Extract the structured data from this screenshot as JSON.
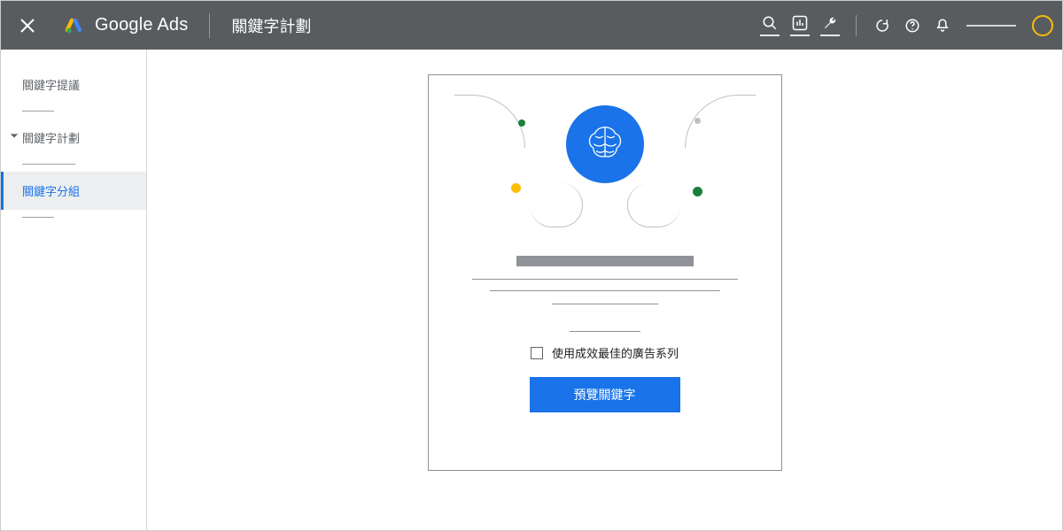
{
  "header": {
    "brand": "Google Ads",
    "page_title": "關鍵字計劃"
  },
  "sidebar": {
    "items": [
      {
        "label": "關鍵字提議",
        "active": false,
        "caret": false
      },
      {
        "label": "關鍵字計劃",
        "active": false,
        "caret": true
      },
      {
        "label": "關鍵字分組",
        "active": true,
        "caret": false
      }
    ]
  },
  "card": {
    "checkbox_label": "使用成效最佳的廣告系列",
    "cta_label": "預覽關鍵字"
  }
}
